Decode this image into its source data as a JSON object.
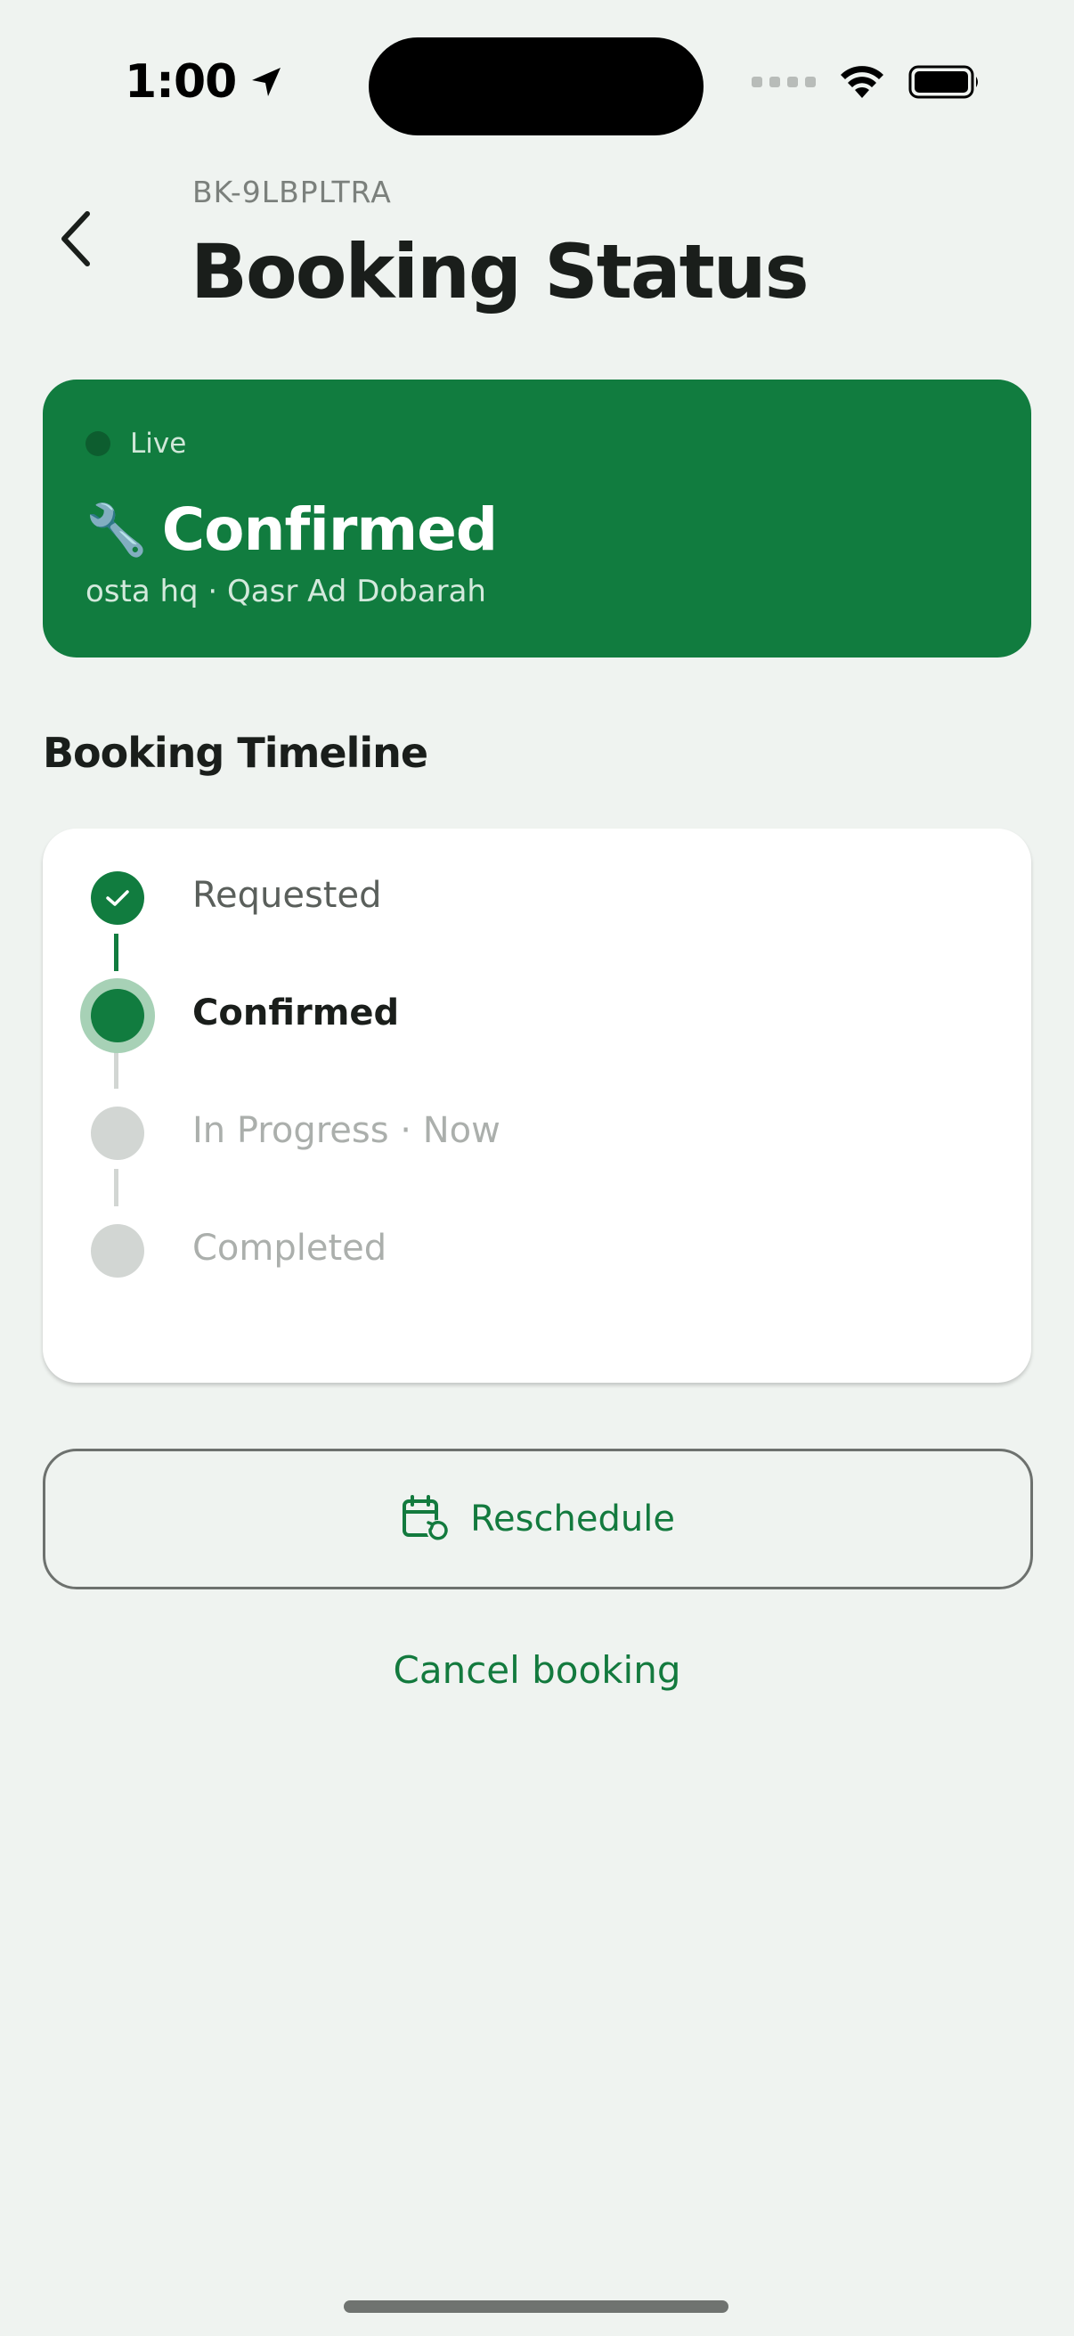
{
  "status_bar": {
    "time": "1:00"
  },
  "header": {
    "booking_id": "BK-9LBPLTRA",
    "title": "Booking Status"
  },
  "live_card": {
    "live_label": "Live",
    "status": "Confirmed",
    "status_emoji": "🔧",
    "subtitle": "osta hq · Qasr Ad Dobarah",
    "color": "#117c3f"
  },
  "timeline": {
    "title": "Booking Timeline",
    "steps": [
      {
        "label": "Requested",
        "state": "done"
      },
      {
        "label": "Confirmed",
        "state": "current"
      },
      {
        "label": "In Progress · Now",
        "state": "pending"
      },
      {
        "label": "Completed",
        "state": "pending"
      }
    ]
  },
  "actions": {
    "reschedule_label": "Reschedule",
    "cancel_label": "Cancel booking"
  },
  "colors": {
    "accent": "#137a3e",
    "background": "#eff3f0",
    "pending": "#d2d6d3"
  }
}
